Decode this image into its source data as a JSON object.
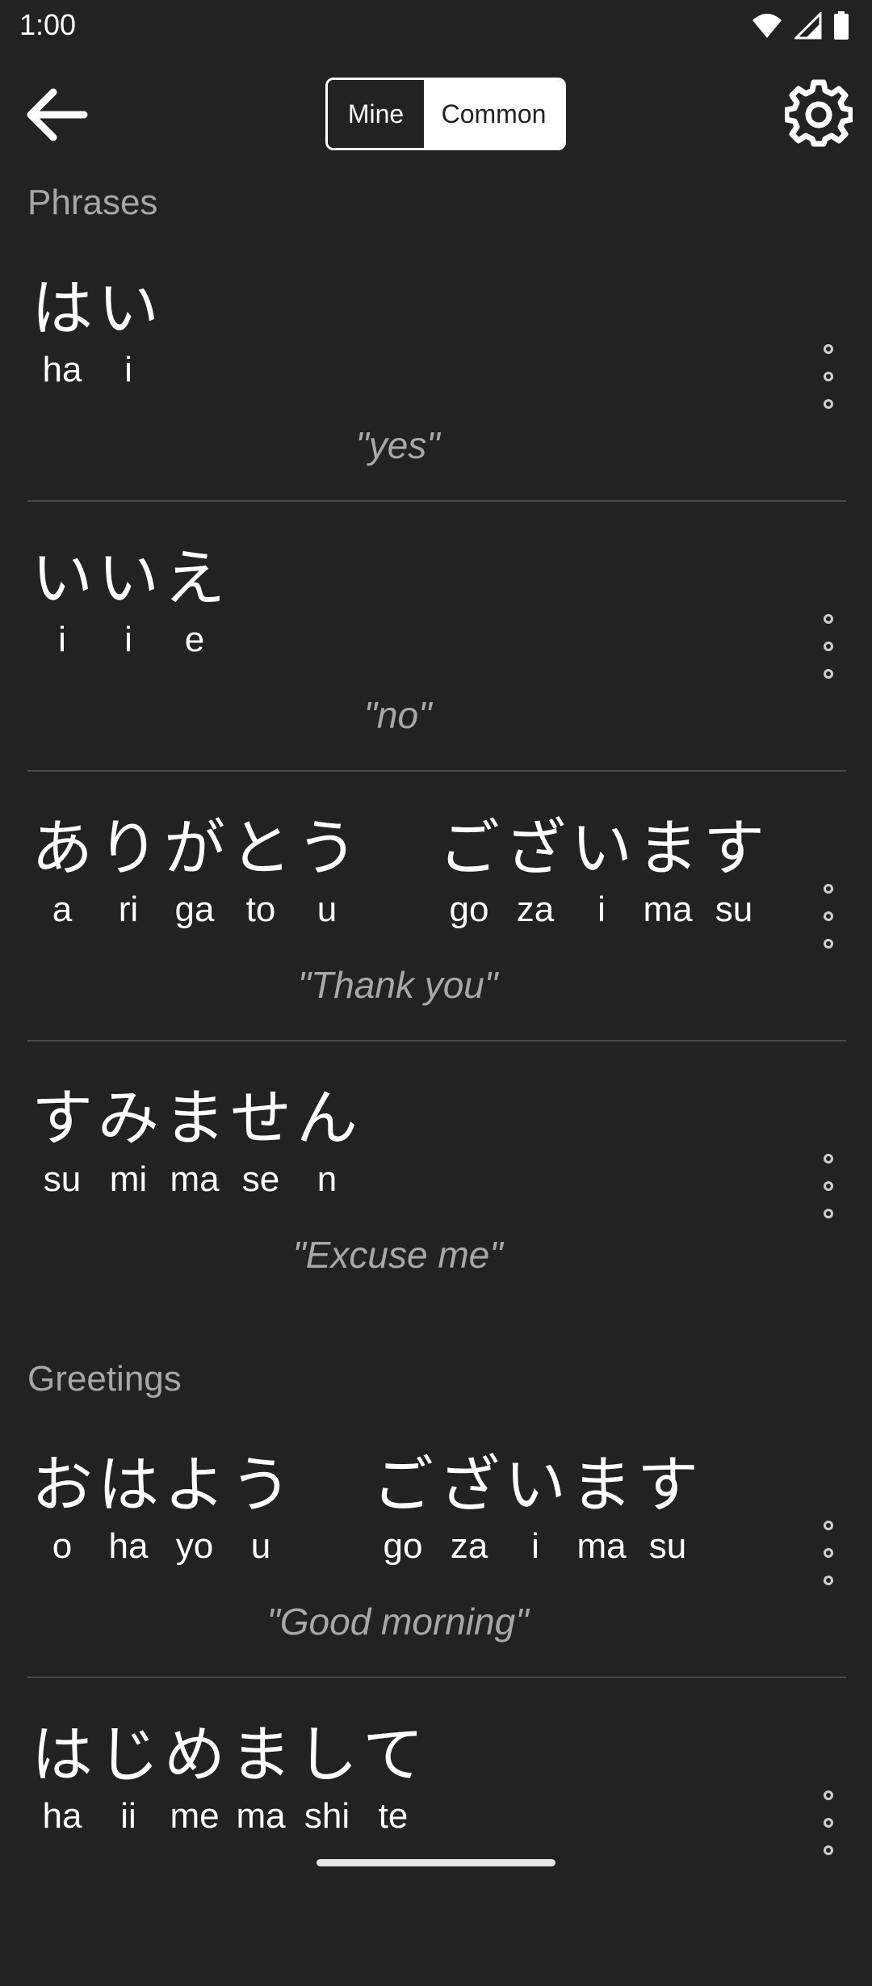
{
  "status_bar": {
    "time": "1:00"
  },
  "toggle": {
    "mine_label": "Mine",
    "common_label": "Common",
    "selected": "Common"
  },
  "sections": {
    "phrases": {
      "title": "Phrases"
    },
    "greetings": {
      "title": "Greetings"
    }
  },
  "phrases": [
    {
      "words": [
        {
          "morae": [
            {
              "kana": "は",
              "romaji": "ha"
            },
            {
              "kana": "い",
              "romaji": "i"
            }
          ]
        }
      ],
      "translation": "\"yes\""
    },
    {
      "words": [
        {
          "morae": [
            {
              "kana": "い",
              "romaji": "i"
            },
            {
              "kana": "い",
              "romaji": "i"
            },
            {
              "kana": "え",
              "romaji": "e"
            }
          ]
        }
      ],
      "translation": "\"no\""
    },
    {
      "words": [
        {
          "morae": [
            {
              "kana": "あ",
              "romaji": "a"
            },
            {
              "kana": "り",
              "romaji": "ri"
            },
            {
              "kana": "が",
              "romaji": "ga"
            },
            {
              "kana": "と",
              "romaji": "to"
            },
            {
              "kana": "う",
              "romaji": "u"
            }
          ]
        },
        {
          "morae": [
            {
              "kana": "ご",
              "romaji": "go"
            },
            {
              "kana": "ざ",
              "romaji": "za"
            },
            {
              "kana": "い",
              "romaji": "i"
            },
            {
              "kana": "ま",
              "romaji": "ma"
            },
            {
              "kana": "す",
              "romaji": "su"
            }
          ]
        }
      ],
      "translation": "\"Thank you\""
    },
    {
      "words": [
        {
          "morae": [
            {
              "kana": "す",
              "romaji": "su"
            },
            {
              "kana": "み",
              "romaji": "mi"
            },
            {
              "kana": "ま",
              "romaji": "ma"
            },
            {
              "kana": "せ",
              "romaji": "se"
            },
            {
              "kana": "ん",
              "romaji": "n"
            }
          ]
        }
      ],
      "translation": "\"Excuse me\""
    }
  ],
  "greetings": [
    {
      "words": [
        {
          "morae": [
            {
              "kana": "お",
              "romaji": "o"
            },
            {
              "kana": "は",
              "romaji": "ha"
            },
            {
              "kana": "よ",
              "romaji": "yo"
            },
            {
              "kana": "う",
              "romaji": "u"
            }
          ]
        },
        {
          "morae": [
            {
              "kana": "ご",
              "romaji": "go"
            },
            {
              "kana": "ざ",
              "romaji": "za"
            },
            {
              "kana": "い",
              "romaji": "i"
            },
            {
              "kana": "ま",
              "romaji": "ma"
            },
            {
              "kana": "す",
              "romaji": "su"
            }
          ]
        }
      ],
      "translation": "\"Good morning\""
    },
    {
      "words": [
        {
          "morae": [
            {
              "kana": "は",
              "romaji": "ha"
            },
            {
              "kana": "じ",
              "romaji": "ii"
            },
            {
              "kana": "め",
              "romaji": "me"
            },
            {
              "kana": "ま",
              "romaji": "ma"
            },
            {
              "kana": "し",
              "romaji": "shi"
            },
            {
              "kana": "て",
              "romaji": "te"
            }
          ]
        }
      ],
      "translation": ""
    }
  ],
  "icons": {
    "back": "arrow-back-icon",
    "settings": "gear-icon",
    "more": "more-vert-icon",
    "wifi": "wifi-icon",
    "signal": "signal-icon",
    "battery": "battery-icon"
  },
  "colors": {
    "background": "#222222",
    "secondary_text": "#a7a7a7",
    "divider": "#4a4a4a"
  }
}
